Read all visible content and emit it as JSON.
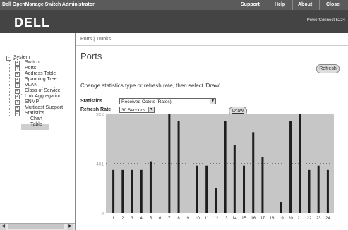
{
  "topbar": {
    "title": "Dell OpenManage Switch Administrator",
    "links": [
      "Support",
      "Help",
      "About",
      "Close"
    ]
  },
  "brand": {
    "logo": "DELL",
    "product": "PowerConnect 5224"
  },
  "sidebar": {
    "items": [
      {
        "label": "System",
        "toggle": "−"
      },
      {
        "label": "Switch",
        "toggle": "+"
      },
      {
        "label": "Ports",
        "toggle": "+"
      },
      {
        "label": "Address Table",
        "toggle": "+"
      },
      {
        "label": "Spanning Tree",
        "toggle": "+"
      },
      {
        "label": "VLAN",
        "toggle": "+"
      },
      {
        "label": "Class of Service",
        "toggle": "+"
      },
      {
        "label": "Link Aggregation",
        "toggle": "+"
      },
      {
        "label": "SNMP",
        "toggle": "+"
      },
      {
        "label": "Multicast Support",
        "toggle": "+"
      },
      {
        "label": "Statistics",
        "toggle": "−"
      },
      {
        "label": "Chart",
        "toggle": ""
      },
      {
        "label": "Table",
        "toggle": ""
      }
    ],
    "selected": "Chart"
  },
  "main": {
    "breadcrumb": {
      "ports": "Ports",
      "sep": "|",
      "trunks": "Trunks"
    },
    "title": "Ports",
    "refresh_label": "Refresh",
    "instruction": "Change statistics type or refresh rate, then select 'Draw'.",
    "statistics_label": "Statistics",
    "statistics_value": "Received Octets (Rates)",
    "refresh_rate_label": "Refresh Rate",
    "refresh_rate_value": "30 Seconds",
    "draw_label": "Draw"
  },
  "chart_data": {
    "type": "bar",
    "categories": [
      "1",
      "2",
      "3",
      "4",
      "5",
      "6",
      "7",
      "8",
      "9",
      "10",
      "11",
      "12",
      "13",
      "14",
      "15",
      "16",
      "17",
      "18",
      "19",
      "20",
      "21",
      "22",
      "23",
      "24"
    ],
    "values": [
      400,
      400,
      400,
      400,
      480,
      0,
      922,
      850,
      0,
      440,
      440,
      230,
      850,
      630,
      440,
      750,
      520,
      0,
      100,
      850,
      922,
      400,
      440,
      400
    ],
    "yticks": [
      922,
      461,
      0
    ],
    "ylim": [
      0,
      922
    ],
    "grid": "dotted at 461",
    "colors": {
      "bar": "#1e1e1e",
      "plot_bg": "#c6c6c6",
      "grid": "#777777"
    }
  }
}
